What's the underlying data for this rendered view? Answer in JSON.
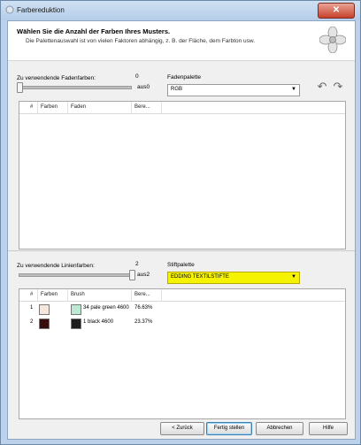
{
  "window": {
    "title": "Farbereduktion",
    "close_glyph": "✕"
  },
  "header": {
    "title": "Wählen Sie die Anzahl der Farben Ihres Musters.",
    "subtitle": "Die Palettenauswahl ist von vielen Faktoren abhängig, z. B. der Fläche, dem Farbton usw."
  },
  "thread_section": {
    "label": "Zu verwendende Fadenfarben:",
    "count": "0",
    "of_label": "aus0",
    "palette_label": "Fadenpalette",
    "palette_value": "RGB",
    "columns": [
      "#",
      "Farben",
      "Faden",
      "Bere..."
    ],
    "rows": []
  },
  "line_section": {
    "label": "Zu verwendende Linienfarben:",
    "count": "2",
    "of_label": "aus2",
    "palette_label": "Stiftpalette",
    "palette_value": "EDDING TEXTILSTIFTE",
    "columns": [
      "#",
      "Farben",
      "Brush",
      "Bere..."
    ],
    "rows": [
      {
        "num": "1",
        "color": "#f7e6dc",
        "brush_color": "#bde8d3",
        "brush": "34 pale green 4600",
        "percent": "76.63%"
      },
      {
        "num": "2",
        "color": "#3b0c0c",
        "brush_color": "#1c1c1c",
        "brush": "1 black 4600",
        "percent": "23.37%"
      }
    ]
  },
  "footer": {
    "back": "< Zurück",
    "finish": "Fertig stellen",
    "cancel": "Abbrechen",
    "help": "Hilfe"
  },
  "icons": {
    "undo": "↶",
    "redo": "↷",
    "combo_arrow": "▼"
  }
}
